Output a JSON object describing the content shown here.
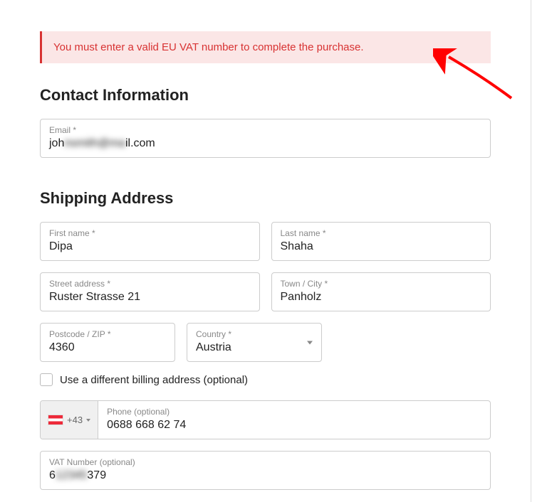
{
  "alert": {
    "message": "You must enter a valid EU VAT number to complete the purchase."
  },
  "contact": {
    "title": "Contact Information",
    "email_label": "Email *",
    "email_prefix": "joh",
    "email_mid_blur": "nsmith@ma",
    "email_suffix": "il.com"
  },
  "shipping": {
    "title": "Shipping Address",
    "first_name_label": "First name *",
    "first_name": "Dipa",
    "last_name_label": "Last name *",
    "last_name": "Shaha",
    "street_label": "Street address *",
    "street": "Ruster Strasse 21",
    "town_label": "Town / City *",
    "town": "Panholz",
    "postcode_label": "Postcode / ZIP *",
    "postcode": "4360",
    "country_label": "Country *",
    "country": "Austria",
    "diff_billing_label": "Use a different billing address (optional)",
    "phone_label": "Phone (optional)",
    "phone_prefix": "+43",
    "phone": "0688 668 62 74",
    "vat_label": "VAT Number (optional)",
    "vat_prefix": "6",
    "vat_mid_blur": "12345",
    "vat_suffix": "379"
  }
}
